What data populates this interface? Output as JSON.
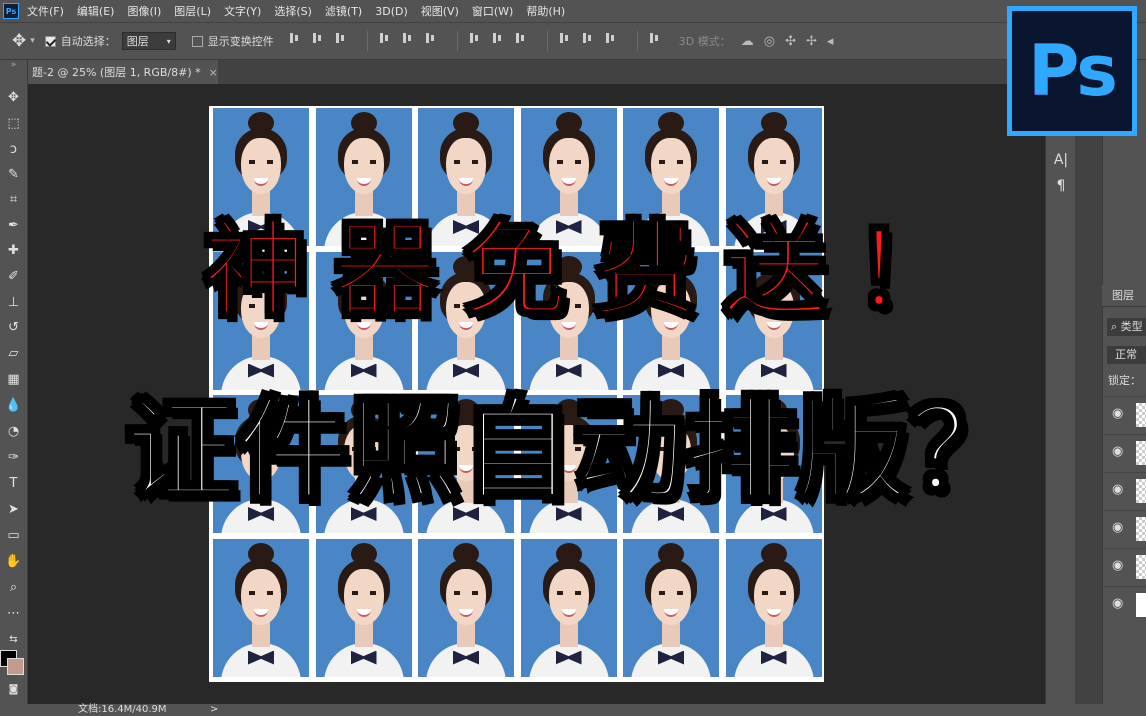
{
  "menu": {
    "logo": "Ps",
    "items": [
      "文件(F)",
      "编辑(E)",
      "图像(I)",
      "图层(L)",
      "文字(Y)",
      "选择(S)",
      "滤镜(T)",
      "3D(D)",
      "视图(V)",
      "窗口(W)",
      "帮助(H)"
    ]
  },
  "options": {
    "auto_select_label": "自动选择：",
    "auto_select_value": "图层",
    "show_transform_label": "显示变换控件",
    "mode_3d_label": "3D 模式："
  },
  "document": {
    "tab_title": "题-2 @ 25% (图层 1, RGB/8#) *",
    "close": "×",
    "photo_count": 24
  },
  "headlines": {
    "line1": "神器免费送！",
    "line2": "证件照自动排版？"
  },
  "logo_badge": {
    "text": "Ps",
    "accent": "#31a8ff",
    "background": "#0a1530"
  },
  "right_strip": {
    "char_icon": "A|",
    "para_icon": "¶"
  },
  "layers_panel": {
    "tab_label": "图层",
    "search_label": "类型",
    "blend_mode": "正常",
    "lock_label": "锁定："
  },
  "status": {
    "doc_size": "文档:16.4M/40.9M",
    "arrow": ">"
  },
  "colors": {
    "panel": "#535353",
    "canvas_bg": "#282828",
    "photo_bg": "#4a86c5",
    "headline_red": "#ff1a1a",
    "headline_white": "#ffffff"
  }
}
